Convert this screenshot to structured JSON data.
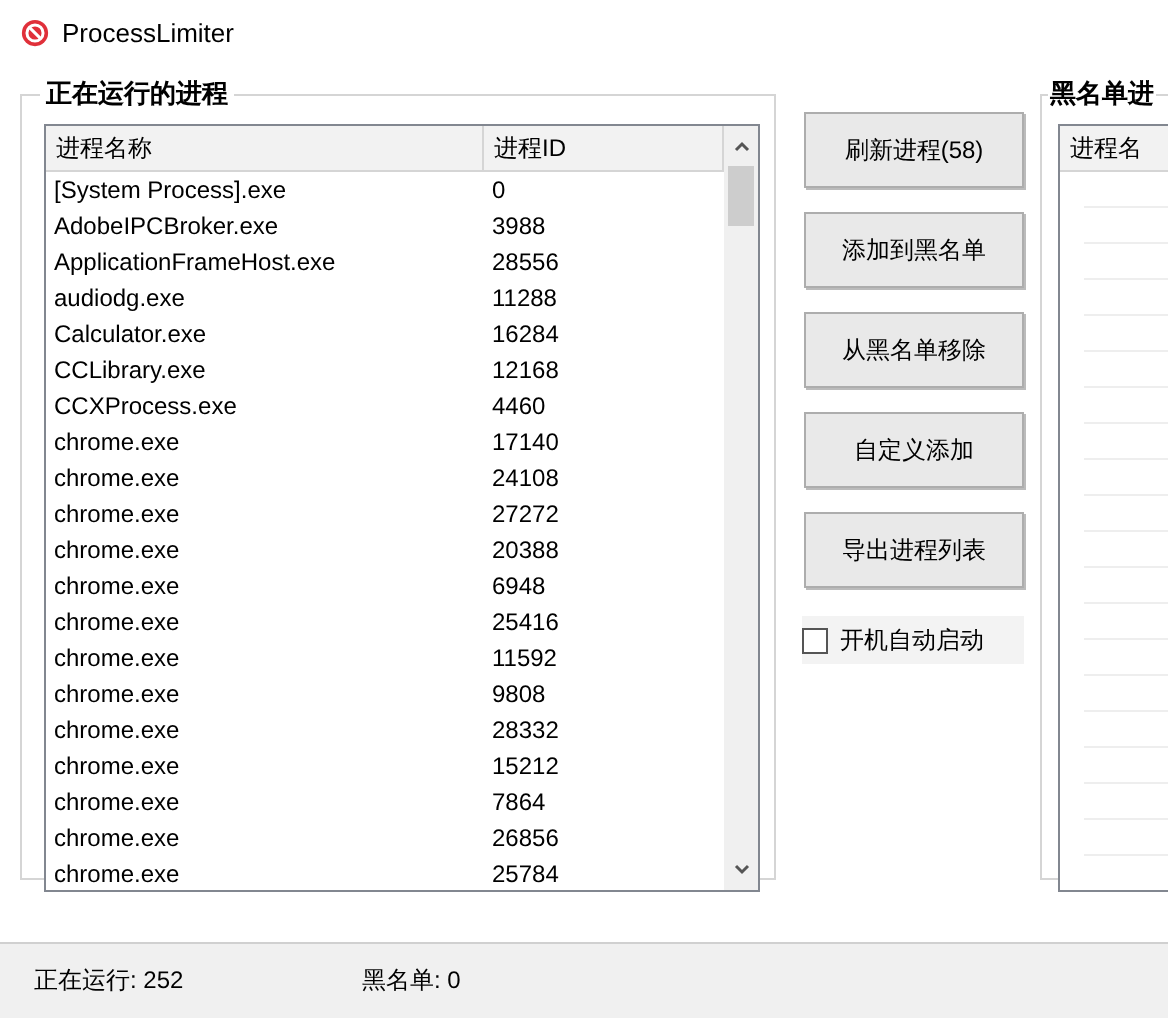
{
  "window": {
    "title": "ProcessLimiter"
  },
  "running": {
    "legend": "正在运行的进程",
    "columns": [
      "进程名称",
      "进程ID"
    ],
    "rows": [
      {
        "name": "[System Process].exe",
        "pid": "0"
      },
      {
        "name": "AdobeIPCBroker.exe",
        "pid": "3988"
      },
      {
        "name": "ApplicationFrameHost.exe",
        "pid": "28556"
      },
      {
        "name": "audiodg.exe",
        "pid": "11288"
      },
      {
        "name": "Calculator.exe",
        "pid": "16284"
      },
      {
        "name": "CCLibrary.exe",
        "pid": "12168"
      },
      {
        "name": "CCXProcess.exe",
        "pid": "4460"
      },
      {
        "name": "chrome.exe",
        "pid": "17140"
      },
      {
        "name": "chrome.exe",
        "pid": "24108"
      },
      {
        "name": "chrome.exe",
        "pid": "27272"
      },
      {
        "name": "chrome.exe",
        "pid": "20388"
      },
      {
        "name": "chrome.exe",
        "pid": "6948"
      },
      {
        "name": "chrome.exe",
        "pid": "25416"
      },
      {
        "name": "chrome.exe",
        "pid": "11592"
      },
      {
        "name": "chrome.exe",
        "pid": "9808"
      },
      {
        "name": "chrome.exe",
        "pid": "28332"
      },
      {
        "name": "chrome.exe",
        "pid": "15212"
      },
      {
        "name": "chrome.exe",
        "pid": "7864"
      },
      {
        "name": "chrome.exe",
        "pid": "26856"
      },
      {
        "name": "chrome.exe",
        "pid": "25784"
      }
    ]
  },
  "buttons": [
    "刷新进程(58)",
    "添加到黑名单",
    "从黑名单移除",
    "自定义添加",
    "导出进程列表"
  ],
  "autostart": {
    "label": "开机自动启动",
    "checked": false
  },
  "blacklist": {
    "legend": "黑名单进",
    "columns": [
      "进程名"
    ]
  },
  "status_bar": [
    "正在运行: 252",
    "黑名单: 0"
  ]
}
